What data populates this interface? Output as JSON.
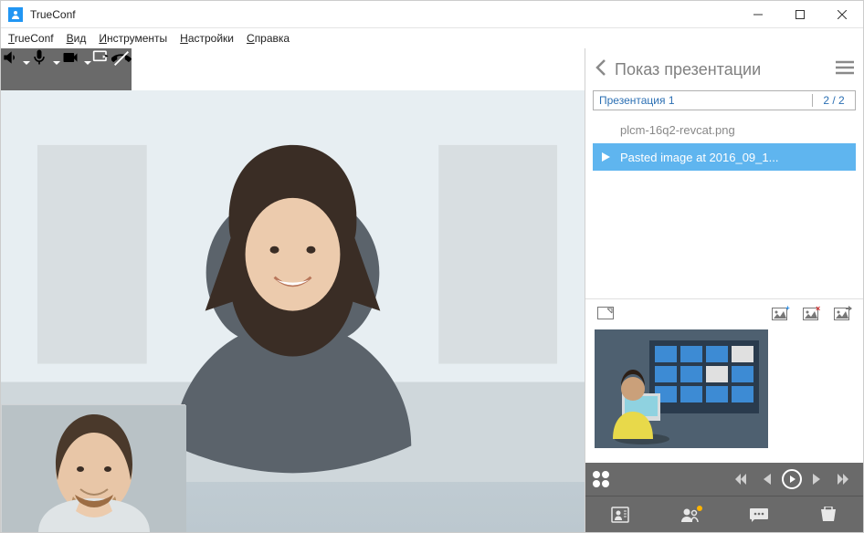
{
  "window": {
    "title": "TrueConf"
  },
  "menu": {
    "items": [
      "TrueConf",
      "Вид",
      "Инструменты",
      "Настройки",
      "Справка"
    ]
  },
  "toolbar": {
    "speaker": "speaker",
    "mic": "microphone",
    "camera": "camera",
    "share": "share-screen",
    "end": "end-call"
  },
  "presentation": {
    "panel_title": "Показ презентации",
    "name": "Презентация 1",
    "page": "2 / 2",
    "items": [
      {
        "label": "plcm-16q2-revcat.png",
        "selected": false
      },
      {
        "label": "Pasted image at 2016_09_1...",
        "selected": true
      }
    ],
    "gallery_actions": {
      "expand": "expand",
      "add_image": "add-image",
      "remove_image": "remove-image",
      "export_image": "export-image"
    }
  },
  "player": {
    "grid": "thumbnail-grid",
    "first": "first",
    "prev": "previous",
    "play": "play",
    "next": "next",
    "last": "last"
  },
  "bottom_tabs": {
    "address_book": "address-book",
    "participants": "participants",
    "chat": "chat",
    "tools": "tools"
  }
}
